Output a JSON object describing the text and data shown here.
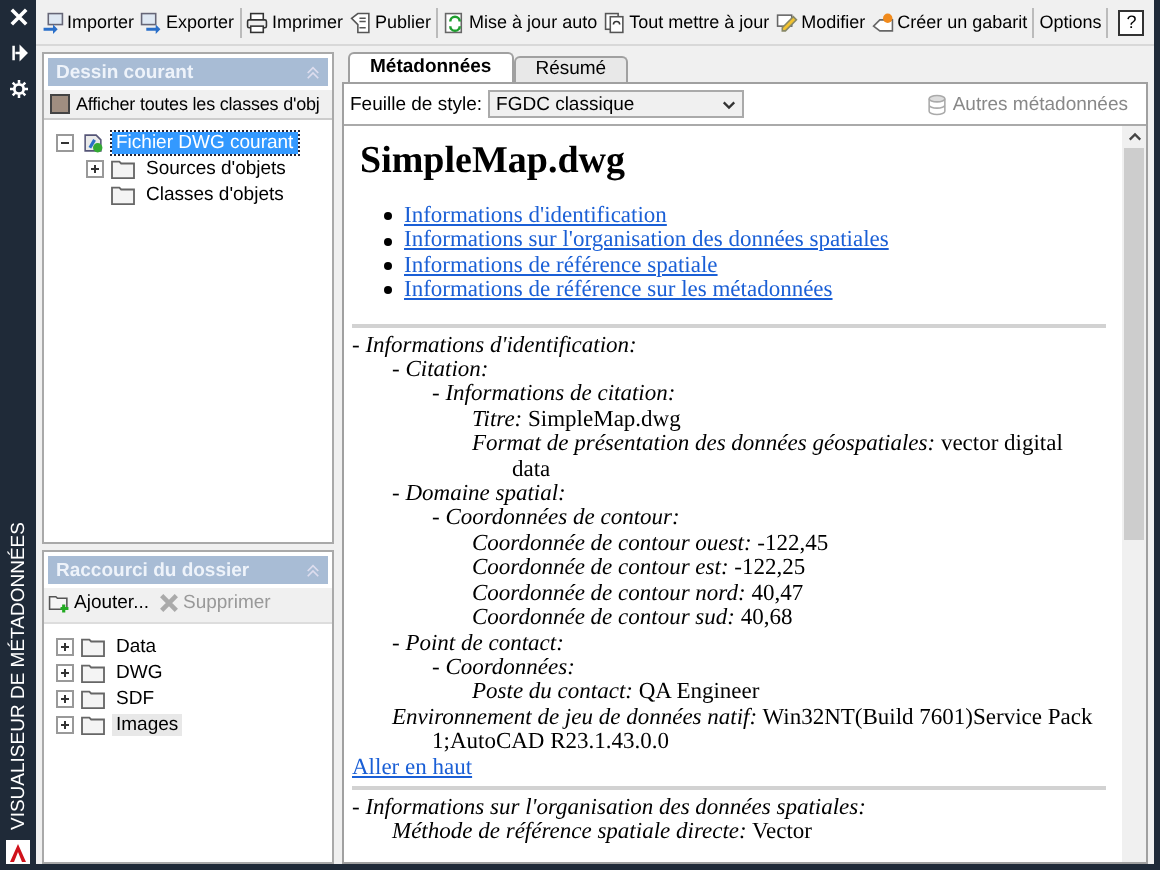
{
  "side_title": "VISUALISEUR DE MÉTADONNÉES",
  "toolbar": [
    {
      "label": "Importer"
    },
    {
      "label": "Exporter"
    },
    {
      "label": "Imprimer"
    },
    {
      "label": "Publier"
    },
    {
      "label": "Mise à jour auto"
    },
    {
      "label": "Tout mettre à jour"
    },
    {
      "label": "Modifier"
    },
    {
      "label": "Créer un gabarit"
    },
    {
      "label": "Options"
    }
  ],
  "help": "?",
  "current_drawing": {
    "title": "Dessin courant",
    "show_all": {
      "label": "Afficher toutes les classes d'obj",
      "checked": false
    },
    "tree": [
      {
        "label": "Fichier DWG courant",
        "selected": true,
        "expandable": true,
        "expanded": true,
        "children": [
          {
            "label": "Sources d'objets",
            "selected": false,
            "expandable": true,
            "expanded": false
          },
          {
            "label": "Classes d'objets",
            "selected": false,
            "expandable": false
          }
        ]
      }
    ]
  },
  "folder_shortcuts": {
    "title": "Raccourci du dossier",
    "actions": [
      {
        "label": "Ajouter...",
        "disabled": false
      },
      {
        "label": "Supprimer",
        "disabled": true
      }
    ],
    "folders": [
      {
        "label": "Data",
        "selected": false,
        "expanded": false
      },
      {
        "label": "DWG",
        "selected": false,
        "expanded": false
      },
      {
        "label": "SDF",
        "selected": false,
        "expanded": false
      },
      {
        "label": "Images",
        "selected": true,
        "expanded": false
      }
    ]
  },
  "tabs": [
    {
      "label": "Métadonnées",
      "selected": true
    },
    {
      "label": "Résumé",
      "selected": false
    }
  ],
  "stylesheet": {
    "label": "Feuille de style:",
    "value": "FGDC classique",
    "other": {
      "label": "Autres métadonnées",
      "disabled": true
    }
  },
  "document": {
    "title": "SimpleMap.dwg",
    "links": [
      "Informations d'identification",
      "Informations sur l'organisation des données spatiales",
      "Informations de référence spatiale",
      "Informations de référence sur les métadonnées"
    ],
    "sections": [
      {
        "items": [
          {
            "kind": "group",
            "label": "- Informations d'identification:",
            "children": [
              {
                "kind": "group",
                "label": "- Citation:",
                "children": [
                  {
                    "kind": "group",
                    "label": "- Informations de citation:",
                    "children": [
                      {
                        "kind": "field",
                        "label": "Titre:",
                        "value": "SimpleMap.dwg"
                      },
                      {
                        "kind": "field",
                        "label": "Format de présentation des données géospatiales:",
                        "value": "vector digital data"
                      }
                    ]
                  }
                ]
              },
              {
                "kind": "group",
                "label": "- Domaine spatial:",
                "children": [
                  {
                    "kind": "group",
                    "label": "- Coordonnées de contour:",
                    "children": [
                      {
                        "kind": "field",
                        "label": "Coordonnée de contour ouest:",
                        "value": "-122,45"
                      },
                      {
                        "kind": "field",
                        "label": "Coordonnée de contour est:",
                        "value": "-122,25"
                      },
                      {
                        "kind": "field",
                        "label": "Coordonnée de contour nord:",
                        "value": "40,47"
                      },
                      {
                        "kind": "field",
                        "label": "Coordonnée de contour sud:",
                        "value": "40,68"
                      }
                    ]
                  }
                ]
              },
              {
                "kind": "group",
                "label": "- Point de contact:",
                "children": [
                  {
                    "kind": "group",
                    "label": "- Coordonnées:",
                    "children": [
                      {
                        "kind": "field",
                        "label": "Poste du contact:",
                        "value": "QA Engineer"
                      }
                    ]
                  }
                ]
              },
              {
                "kind": "field",
                "label": "Environnement de jeu de données natif:",
                "value": "Win32NT(Build 7601)Service Pack 1;AutoCAD R23.1.43.0.0"
              }
            ]
          }
        ],
        "top_link": "Aller en haut"
      },
      {
        "items": [
          {
            "kind": "group",
            "label": "- Informations sur l'organisation des données spatiales:",
            "children": [
              {
                "kind": "field",
                "label": "Méthode de référence spatiale directe:",
                "value": "Vector"
              }
            ]
          }
        ]
      }
    ]
  }
}
